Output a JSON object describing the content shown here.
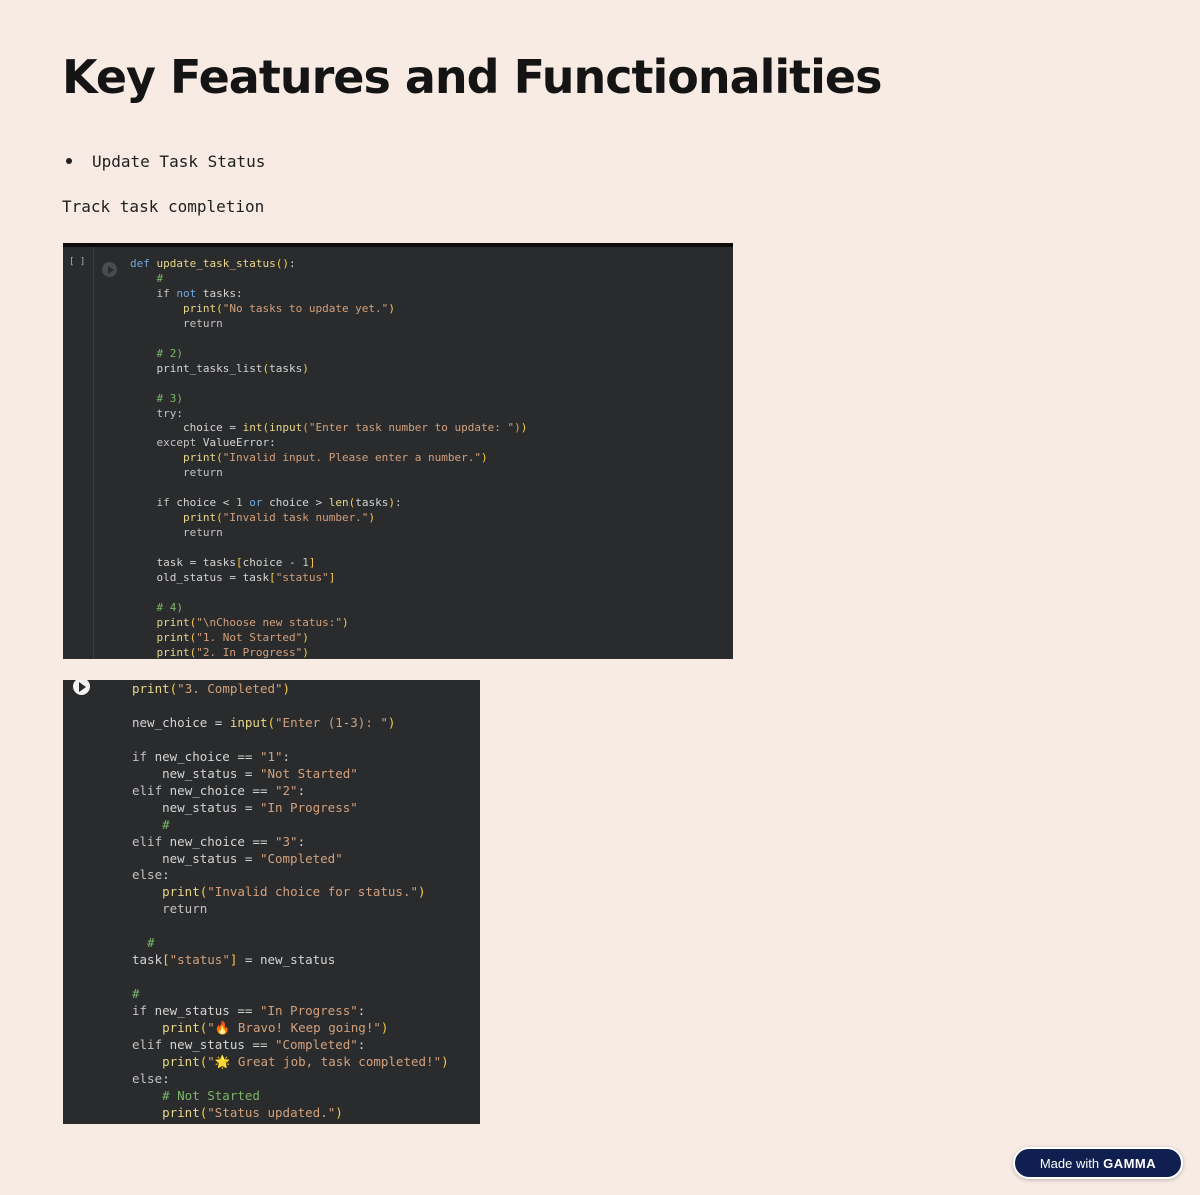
{
  "page": {
    "title": "Key Features and Functionalities",
    "bullet": "Update Task Status",
    "subtext": "Track task completion"
  },
  "cell1": {
    "bracket": "[ ]",
    "lines": [
      [
        [
          "kw",
          "def "
        ],
        [
          "fn",
          "update_task_status"
        ],
        [
          "par",
          "()"
        ],
        [
          "",
          ""
        ],
        [
          "",
          ""
        ],
        [
          "",
          ":"
        ]
      ],
      [
        [
          "cm",
          "    #"
        ]
      ],
      [
        [
          "",
          "    "
        ],
        [
          "kw2",
          "if "
        ],
        [
          "kw",
          "not "
        ],
        [
          "",
          "tasks:"
        ]
      ],
      [
        [
          "",
          "        "
        ],
        [
          "fn",
          "print"
        ],
        [
          "par",
          "("
        ],
        [
          "str",
          "\"No tasks to update yet.\""
        ],
        [
          "par",
          ")"
        ]
      ],
      [
        [
          "",
          "        "
        ],
        [
          "kw2",
          "return"
        ]
      ],
      [
        [
          "",
          ""
        ]
      ],
      [
        [
          "cm",
          "    # 2)"
        ]
      ],
      [
        [
          "",
          "    print_tasks_list"
        ],
        [
          "par",
          "("
        ],
        [
          "",
          "tasks"
        ],
        [
          "par",
          ")"
        ]
      ],
      [
        [
          "",
          ""
        ]
      ],
      [
        [
          "cm",
          "    # 3)"
        ]
      ],
      [
        [
          "",
          "    "
        ],
        [
          "kw2",
          "try"
        ],
        [
          "",
          ":"
        ]
      ],
      [
        [
          "",
          "        choice = "
        ],
        [
          "fn",
          "int"
        ],
        [
          "par",
          "("
        ],
        [
          "fn",
          "input"
        ],
        [
          "br",
          "("
        ],
        [
          "str",
          "\"Enter task number to update: \""
        ],
        [
          "br",
          ")"
        ],
        [
          "par",
          ")"
        ]
      ],
      [
        [
          "",
          "    "
        ],
        [
          "kw2",
          "except "
        ],
        [
          "",
          "ValueError:"
        ]
      ],
      [
        [
          "",
          "        "
        ],
        [
          "fn",
          "print"
        ],
        [
          "par",
          "("
        ],
        [
          "str",
          "\"Invalid input. Please enter a number.\""
        ],
        [
          "par",
          ")"
        ]
      ],
      [
        [
          "",
          "        "
        ],
        [
          "kw2",
          "return"
        ]
      ],
      [
        [
          "",
          ""
        ]
      ],
      [
        [
          "",
          "    "
        ],
        [
          "kw2",
          "if "
        ],
        [
          "",
          "choice < "
        ],
        [
          "num",
          "1"
        ],
        [
          "kw",
          " or "
        ],
        [
          "",
          "choice > "
        ],
        [
          "fn",
          "len"
        ],
        [
          "par",
          "("
        ],
        [
          "",
          "tasks"
        ],
        [
          "par",
          ")"
        ],
        [
          "",
          ":"
        ]
      ],
      [
        [
          "",
          "        "
        ],
        [
          "fn",
          "print"
        ],
        [
          "par",
          "("
        ],
        [
          "str",
          "\"Invalid task number.\""
        ],
        [
          "par",
          ")"
        ]
      ],
      [
        [
          "",
          "        "
        ],
        [
          "kw2",
          "return"
        ]
      ],
      [
        [
          "",
          ""
        ]
      ],
      [
        [
          "",
          "    task = tasks"
        ],
        [
          "par",
          "["
        ],
        [
          "",
          "choice - "
        ],
        [
          "num",
          "1"
        ],
        [
          "par",
          "]"
        ]
      ],
      [
        [
          "",
          "    old_status = task"
        ],
        [
          "par",
          "["
        ],
        [
          "str",
          "\"status\""
        ],
        [
          "par",
          "]"
        ]
      ],
      [
        [
          "",
          ""
        ]
      ],
      [
        [
          "cm",
          "    # 4)"
        ]
      ],
      [
        [
          "",
          "    "
        ],
        [
          "fn",
          "print"
        ],
        [
          "par",
          "("
        ],
        [
          "str",
          "\"\\nChoose new status:\""
        ],
        [
          "par",
          ")"
        ]
      ],
      [
        [
          "",
          "    "
        ],
        [
          "fn",
          "print"
        ],
        [
          "par",
          "("
        ],
        [
          "str",
          "\"1. Not Started\""
        ],
        [
          "par",
          ")"
        ]
      ],
      [
        [
          "",
          "    "
        ],
        [
          "fn",
          "print"
        ],
        [
          "par",
          "("
        ],
        [
          "str",
          "\"2. In Progress\""
        ],
        [
          "par",
          ")"
        ]
      ]
    ]
  },
  "cell2": {
    "lines": [
      [
        [
          "fn",
          "print"
        ],
        [
          "par",
          "("
        ],
        [
          "str",
          "\"3. Completed\""
        ],
        [
          "par",
          ")"
        ]
      ],
      [
        [
          "",
          ""
        ]
      ],
      [
        [
          "",
          "new_choice = "
        ],
        [
          "fn",
          "input"
        ],
        [
          "par",
          "("
        ],
        [
          "str",
          "\"Enter (1-3): \""
        ],
        [
          "par",
          ")"
        ]
      ],
      [
        [
          "",
          ""
        ]
      ],
      [
        [
          "kw2",
          "if "
        ],
        [
          "",
          "new_choice == "
        ],
        [
          "str",
          "\"1\""
        ],
        [
          "",
          ":"
        ]
      ],
      [
        [
          "",
          "    new_status = "
        ],
        [
          "str",
          "\"Not Started\""
        ]
      ],
      [
        [
          "kw2",
          "elif "
        ],
        [
          "",
          "new_choice == "
        ],
        [
          "str",
          "\"2\""
        ],
        [
          "",
          ":"
        ]
      ],
      [
        [
          "",
          "    new_status = "
        ],
        [
          "str",
          "\"In Progress\""
        ]
      ],
      [
        [
          "cm",
          "    #"
        ]
      ],
      [
        [
          "kw2",
          "elif "
        ],
        [
          "",
          "new_choice == "
        ],
        [
          "str",
          "\"3\""
        ],
        [
          "",
          ":"
        ]
      ],
      [
        [
          "",
          "    new_status = "
        ],
        [
          "str",
          "\"Completed\""
        ]
      ],
      [
        [
          "kw2",
          "else"
        ],
        [
          "",
          ":"
        ]
      ],
      [
        [
          "",
          "    "
        ],
        [
          "fn",
          "print"
        ],
        [
          "par",
          "("
        ],
        [
          "str",
          "\"Invalid choice for status.\""
        ],
        [
          "par",
          ")"
        ]
      ],
      [
        [
          "",
          "    "
        ],
        [
          "kw2",
          "return"
        ]
      ],
      [
        [
          "",
          ""
        ]
      ],
      [
        [
          "cm",
          "  #"
        ]
      ],
      [
        [
          "",
          "task"
        ],
        [
          "par",
          "["
        ],
        [
          "str",
          "\"status\""
        ],
        [
          "par",
          "]"
        ],
        [
          "",
          " = new_status"
        ]
      ],
      [
        [
          "",
          ""
        ]
      ],
      [
        [
          "cm",
          "#"
        ]
      ],
      [
        [
          "kw2",
          "if "
        ],
        [
          "",
          "new_status == "
        ],
        [
          "str",
          "\"In Progress\""
        ],
        [
          "",
          ":"
        ]
      ],
      [
        [
          "",
          "    "
        ],
        [
          "fn",
          "print"
        ],
        [
          "par",
          "("
        ],
        [
          "str",
          "\"🔥 Bravo! Keep going!\""
        ],
        [
          "par",
          ")"
        ]
      ],
      [
        [
          "kw2",
          "elif "
        ],
        [
          "",
          "new_status == "
        ],
        [
          "str",
          "\"Completed\""
        ],
        [
          "",
          ":"
        ]
      ],
      [
        [
          "",
          "    "
        ],
        [
          "fn",
          "print"
        ],
        [
          "par",
          "("
        ],
        [
          "str",
          "\"🌟 Great job, task completed!\""
        ],
        [
          "par",
          ")"
        ]
      ],
      [
        [
          "kw2",
          "else"
        ],
        [
          "",
          ":"
        ]
      ],
      [
        [
          "cm",
          "    # Not Started"
        ]
      ],
      [
        [
          "",
          "    "
        ],
        [
          "fn",
          "print"
        ],
        [
          "par",
          "("
        ],
        [
          "str",
          "\"Status updated.\""
        ],
        [
          "par",
          ")"
        ]
      ]
    ]
  },
  "badge": {
    "prefix": "Made with",
    "brand": "GAMMA"
  },
  "colors": {
    "background": "#f8ebe4",
    "code_bg": "#2a2b2d",
    "badge_bg": "#0f1f4f"
  }
}
